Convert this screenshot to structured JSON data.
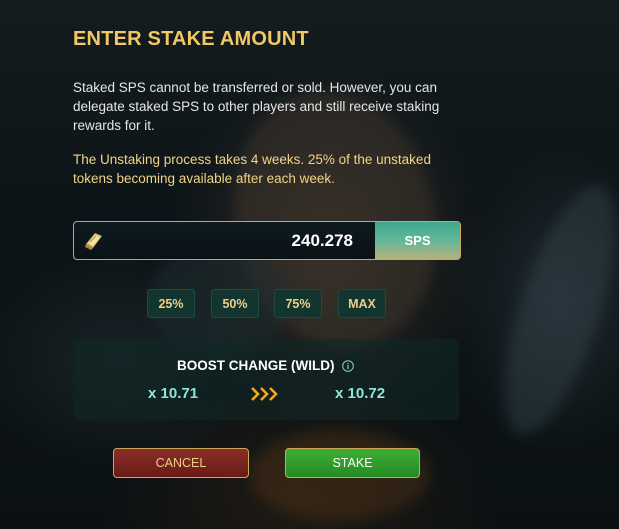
{
  "title": "ENTER STAKE AMOUNT",
  "description": "Staked SPS cannot be transferred or sold. However, you can delegate staked SPS to other players and still receive staking rewards for it.",
  "note": "The Unstaking process takes 4 weeks. 25% of the unstaked tokens becoming available after each week.",
  "stake_input": {
    "value": "240.278",
    "unit": "SPS",
    "icon": "sps-token-icon"
  },
  "percent_buttons": [
    "25%",
    "50%",
    "75%",
    "MAX"
  ],
  "boost": {
    "title": "BOOST CHANGE (WILD)",
    "from": "x 10.71",
    "to": "x 10.72",
    "info_icon": "info-icon",
    "arrow_icon": "triple-chevron-right-icon"
  },
  "buttons": {
    "cancel": "CANCEL",
    "stake": "STAKE"
  },
  "colors": {
    "title": "#f2c866",
    "note": "#f2d484",
    "accent_border": "#c9a85a",
    "boost_value": "#8fe6d6",
    "cancel_bg": "#7a2420",
    "stake_bg": "#2f9b2b"
  }
}
